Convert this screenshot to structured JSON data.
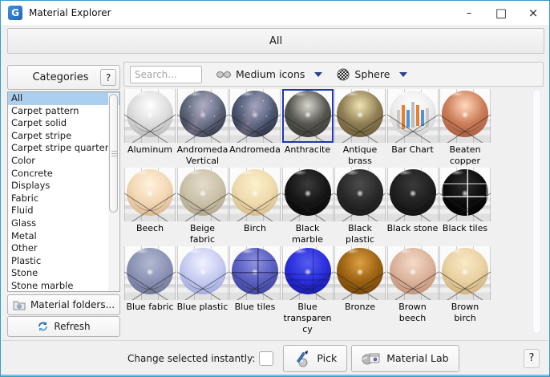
{
  "window": {
    "title": "Material Explorer",
    "controls": {
      "minimize": "–",
      "maximize": "□",
      "close": "×"
    }
  },
  "header": {
    "label": "All"
  },
  "sidebar": {
    "title": "Categories",
    "help_label": "?",
    "items": [
      {
        "label": "All",
        "selected": true
      },
      {
        "label": "Carpet pattern"
      },
      {
        "label": "Carpet solid"
      },
      {
        "label": "Carpet stripe"
      },
      {
        "label": "Carpet stripe quarter"
      },
      {
        "label": "Color"
      },
      {
        "label": "Concrete"
      },
      {
        "label": "Displays"
      },
      {
        "label": "Fabric"
      },
      {
        "label": "Fluid"
      },
      {
        "label": "Glass"
      },
      {
        "label": "Metal"
      },
      {
        "label": "Other"
      },
      {
        "label": "Plastic"
      },
      {
        "label": "Stone"
      },
      {
        "label": "Stone marble"
      }
    ],
    "folders_button": "Material folders...",
    "refresh_button": "Refresh"
  },
  "toolbar": {
    "search_placeholder": "Search...",
    "icon_size_label": "Medium icons",
    "shape_label": "Sphere"
  },
  "materials": {
    "selected_name": "Anthracite",
    "columns_per_row": 7,
    "items": [
      {
        "name": "Aluminum",
        "hi": "#ffffff",
        "base": "#dcdcdc",
        "dark": "#b2b2b2"
      },
      {
        "name": "Andromeda Vertical",
        "hi": "#a8aec6",
        "base": "#5b6378",
        "dark": "#2e3340",
        "variant": "galaxy"
      },
      {
        "name": "Andromeda",
        "hi": "#97a0bc",
        "base": "#4d5670",
        "dark": "#262b3a",
        "variant": "galaxy"
      },
      {
        "name": "Anthracite",
        "hi": "#d6d6cd",
        "base": "#56564f",
        "dark": "#3a3a36",
        "selected": true
      },
      {
        "name": "Antique brass",
        "hi": "#f0e3b2",
        "base": "#8e7d52",
        "dark": "#665838"
      },
      {
        "name": "Bar Chart",
        "hi": "#ffffff",
        "base": "#ececec",
        "dark": "#c9c9c9",
        "variant": "bars"
      },
      {
        "name": "Beaten copper",
        "hi": "#ffd9bd",
        "base": "#cb7c57",
        "dark": "#a2593b"
      },
      {
        "name": "Beech",
        "hi": "#fff2dc",
        "base": "#f2d7b4",
        "dark": "#d5b189"
      },
      {
        "name": "Beige fabric",
        "hi": "#e3dccb",
        "base": "#cbc1a9",
        "dark": "#aca28a"
      },
      {
        "name": "Birch",
        "hi": "#fdf0cc",
        "base": "#eedbae",
        "dark": "#d0b583"
      },
      {
        "name": "Black marble",
        "hi": "#3a3a3a",
        "base": "#161616",
        "dark": "#060606"
      },
      {
        "name": "Black plastic",
        "hi": "#4c4c4c",
        "base": "#2a2a2a",
        "dark": "#181818"
      },
      {
        "name": "Black stone",
        "hi": "#3a3a3a",
        "base": "#202020",
        "dark": "#0e0e0e"
      },
      {
        "name": "Black tiles",
        "hi": "#2e2e2e",
        "base": "#0c0c0c",
        "dark": "#000000",
        "variant": "tiles-light"
      },
      {
        "name": "Blue fabric",
        "hi": "#b3b9d2",
        "base": "#8b92b4",
        "dark": "#6b7294"
      },
      {
        "name": "Blue plastic",
        "hi": "#f0f2ff",
        "base": "#c5cbf1",
        "dark": "#99a1d8"
      },
      {
        "name": "Blue tiles",
        "hi": "#8d92dd",
        "base": "#5a5fc2",
        "dark": "#3b3f92",
        "variant": "tiles-dark"
      },
      {
        "name": "Blue transparency",
        "hi": "#565cee",
        "base": "#2a2edd",
        "dark": "#1518a6",
        "variant": "trans"
      },
      {
        "name": "Bronze",
        "hi": "#dda041",
        "base": "#9c6212",
        "dark": "#6b4008"
      },
      {
        "name": "Brown beech",
        "hi": "#f4dac8",
        "base": "#dbb29a",
        "dark": "#bb8d72"
      },
      {
        "name": "Brown birch",
        "hi": "#f9e9c6",
        "base": "#e9d1a2",
        "dark": "#c9ab77"
      }
    ]
  },
  "footer": {
    "instant_label": "Change selected instantly:",
    "pick_button": "Pick",
    "material_lab_button": "Material Lab",
    "help_label": "?"
  },
  "icons": {
    "app": "app-logo-icon",
    "icon_size": "glasses-icon",
    "shape": "checkered-sphere-icon",
    "folders": "folder-icon",
    "refresh": "refresh-icon",
    "pick": "eyedropper-icon",
    "material_lab": "material-lab-icon"
  }
}
